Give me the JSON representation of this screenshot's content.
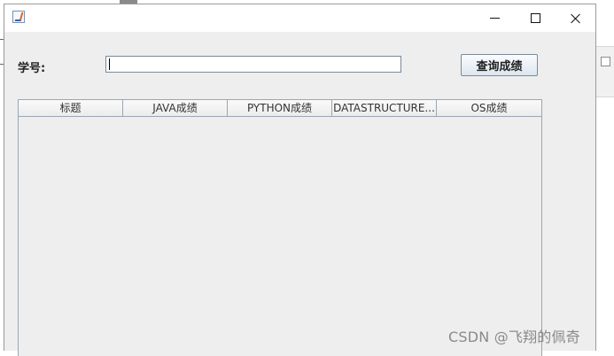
{
  "window": {
    "title": "",
    "controls": {
      "minimize_icon": "minimize-icon",
      "maximize_icon": "maximize-icon",
      "close_icon": "close-icon"
    }
  },
  "form": {
    "student_id_label": "学号:",
    "student_id_value": "",
    "query_button_label": "查询成绩"
  },
  "table": {
    "columns": [
      "标题",
      "JAVA成绩",
      "PYTHON成绩",
      "DATASTRUCTURE...",
      "OS成绩"
    ],
    "rows": []
  },
  "watermark": "CSDN @飞翔的佩奇"
}
